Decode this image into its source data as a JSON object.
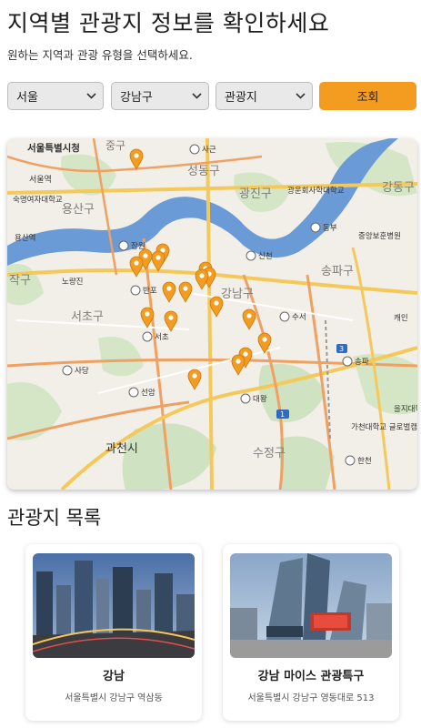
{
  "header": {
    "title": "지역별 관광지 정보를 확인하세요",
    "subtitle": "원하는 지역과 관광 유형을 선택하세요."
  },
  "filters": {
    "region": "서울",
    "district": "강남구",
    "type": "관광지",
    "search_label": "조회"
  },
  "map": {
    "labels": {
      "seoul_city_hall": "서울특별시청",
      "jung_gu": "중구",
      "seoul_station": "서울역",
      "yongsan_gu": "용산구",
      "sookmyung": "숙명여자대학교",
      "yongsan_st": "용산역",
      "seongdong_gu": "성동구",
      "gwangjin_gu": "광진구",
      "gwangjin_univ": "광운회사학대학교",
      "gangdong_gu": "강동구",
      "jungang_vet": "중앙보훈병원",
      "songpa_gu": "송파구",
      "seocho_gu": "서초구",
      "gangnam_gu": "강남구",
      "jak_gu": "작구",
      "noryangjin": "노량진",
      "gwacheon": "과천시",
      "sujeong_gu": "수정구",
      "gachon": "가천대학교 글로벌캠퍼스",
      "ic_sageun": "사근",
      "ic_dongbu": "동부",
      "ic_jamwon": "잠원",
      "ic_banpo": "반포",
      "ic_sincheon": "신천",
      "ic_suseo": "수서",
      "ic_seocho": "서초",
      "ic_sadang": "사당",
      "ic_seonam": "선암",
      "ic_daewang": "대왕",
      "ic_songpa": "송파",
      "ic_hancheon": "한천",
      "route_3": "3",
      "route_1": "1",
      "kemmin": "캐인",
      "eulji": "을지대학교 캠퍼스"
    }
  },
  "attractions_section": {
    "title": "관광지 목록"
  },
  "attractions": [
    {
      "name": "강남",
      "address": "서울특별시 강남구 역삼동"
    },
    {
      "name": "강남 마이스 관광특구",
      "address": "서울특별시 강남구 영동대로 513"
    }
  ],
  "colors": {
    "accent": "#f39c1f",
    "river": "#6b9bd6",
    "park": "#cfe2c2",
    "road_major": "#f5c85a",
    "road_minor": "#f0a060"
  }
}
